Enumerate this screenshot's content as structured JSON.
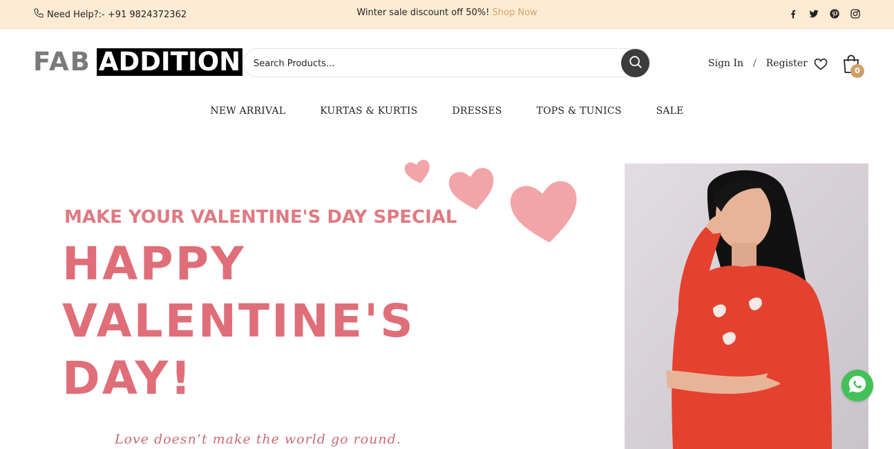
{
  "topbar": {
    "help_text": "Need Help?:- +91 9824372362",
    "promo_text": "Winter sale discount off 50%!",
    "promo_link": "Shop Now",
    "social_icons": [
      "facebook-icon",
      "twitter-icon",
      "pinterest-icon",
      "instagram-icon"
    ]
  },
  "header": {
    "logo_part1": "FAB",
    "logo_part2": "ADDITION",
    "search_placeholder": "Search Products...",
    "sign_in": "Sign In",
    "separator": "/",
    "register": "Register",
    "cart_count": "0"
  },
  "nav": {
    "items": [
      {
        "label": "NEW ARRIVAL"
      },
      {
        "label": "KURTAS & KURTIS"
      },
      {
        "label": "DRESSES"
      },
      {
        "label": "TOPS & TUNICS"
      },
      {
        "label": "SALE"
      }
    ]
  },
  "hero": {
    "kicker": "MAKE YOUR VALENTINE'S DAY SPECIAL",
    "line1": "HAPPY",
    "line2": "VALENTINE'S",
    "line3": "DAY!",
    "tagline": "Love doesn’t make the world go round."
  },
  "colors": {
    "topbar_bg": "#fdebd3",
    "accent": "#d6a46b",
    "hero_text": "#df6e79",
    "heart": "#f2a5a8",
    "whatsapp": "#43c159"
  }
}
